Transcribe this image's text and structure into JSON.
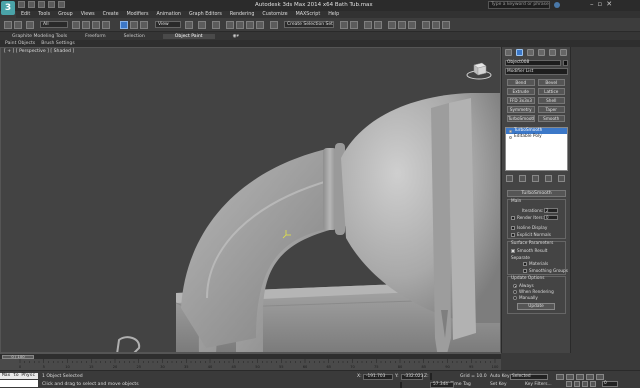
{
  "window": {
    "logo": "3",
    "title": "Autodesk 3ds Max 2014 x64    Bath Tub.max",
    "search_placeholder": "Type a keyword or phrase"
  },
  "menu": [
    "Edit",
    "Tools",
    "Group",
    "Views",
    "Create",
    "Modifiers",
    "Animation",
    "Graph Editors",
    "Rendering",
    "Customize",
    "MAXScript",
    "Help"
  ],
  "toolbar": {
    "selection_filter": "All",
    "reference_coord": "View",
    "named_selection": "Create Selection Set"
  },
  "ribbon": {
    "tabs": [
      "Graphite Modeling Tools",
      "Freeform",
      "Selection",
      "Object Paint"
    ],
    "active_tab": "Object Paint",
    "subtabs": [
      "Paint Objects",
      "Brush Settings"
    ]
  },
  "viewport": {
    "label": "[ + ] [ Perspective ] [ Shaded ]"
  },
  "command_panel": {
    "object_name": "Object008",
    "modifier_list": "Modifier List",
    "modifier_buttons": [
      "Bend",
      "Bevel",
      "Extrude",
      "Lattice",
      "FFD 3x3x3",
      "Shell",
      "Symmetry",
      "Taper",
      "TurboSmooth",
      "Smooth"
    ],
    "stack": [
      {
        "label": "TurboSmooth",
        "selected": true
      },
      {
        "label": "Editable Poly",
        "selected": false
      }
    ],
    "rollout_title": "TurboSmooth",
    "main": {
      "group_label": "Main",
      "iterations_label": "Iterations:",
      "iterations_value": "2",
      "render_iters_label": "Render Iters:",
      "render_iters_value": "0",
      "isoline_label": "Isoline Display",
      "explicit_normals_label": "Explicit Normals"
    },
    "surface": {
      "group_label": "Surface Parameters",
      "smooth_result_label": "Smooth Result",
      "separate_label": "Separate",
      "materials_label": "Materials",
      "smoothing_groups_label": "Smoothing Groups"
    },
    "update": {
      "group_label": "Update Options",
      "always_label": "Always",
      "when_rendering_label": "When Rendering",
      "manually_label": "Manually",
      "update_button": "Update"
    }
  },
  "timeline": {
    "slider_text": "0 / 100",
    "ticks": [
      "0",
      "5",
      "10",
      "15",
      "20",
      "25",
      "30",
      "35",
      "40",
      "45",
      "50",
      "55",
      "60",
      "65",
      "70",
      "75",
      "80",
      "85",
      "90",
      "95",
      "100"
    ]
  },
  "status": {
    "maxscript": "Max to Physc",
    "line1": "1 Object Selected",
    "line2": "Click and drag to select and move objects",
    "x_label": "X:",
    "x_value": "-191.703",
    "y_label": "Y:",
    "y_value": "-332.023",
    "z_label": "Z:",
    "z_value": "57.344",
    "grid": "Grid = 10.0",
    "add_time_tag": "Add Time Tag",
    "auto_key": "Auto Key",
    "selected": "Selected",
    "set_key": "Set Key",
    "key_filters": "Key Filters...",
    "frame": "0"
  }
}
